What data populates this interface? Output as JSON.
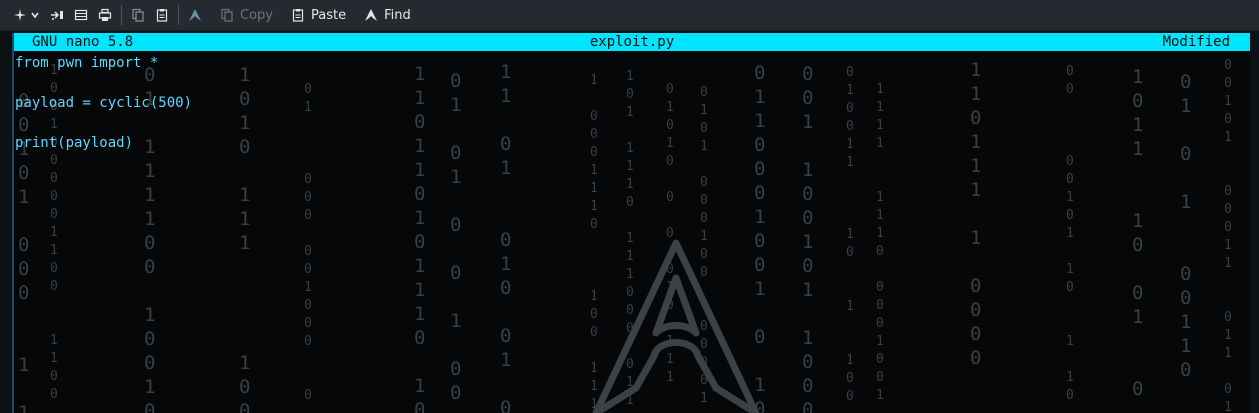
{
  "toolbar": {
    "copy_label": "Copy",
    "paste_label": "Paste",
    "find_label": "Find"
  },
  "nano": {
    "version": "GNU nano 5.8",
    "filename": "exploit.py",
    "status": "Modified",
    "lines": [
      "from pwn import *",
      "",
      "payload = cyclic(500)",
      "",
      "print(payload)"
    ]
  },
  "colors": {
    "titlebar_bg": "#00e5ff",
    "code_text": "#5fd7ff",
    "toolbar_bg": "#252a30",
    "terminal_bg": "#050708"
  },
  "icons": [
    "new-tab-icon",
    "chevron-down-icon",
    "split-view-icon",
    "tab-list-icon",
    "print-icon",
    "copy-doc-icon",
    "clipboard-icon",
    "arch-logo-icon",
    "copy-icon",
    "paste-icon",
    "find-icon"
  ]
}
